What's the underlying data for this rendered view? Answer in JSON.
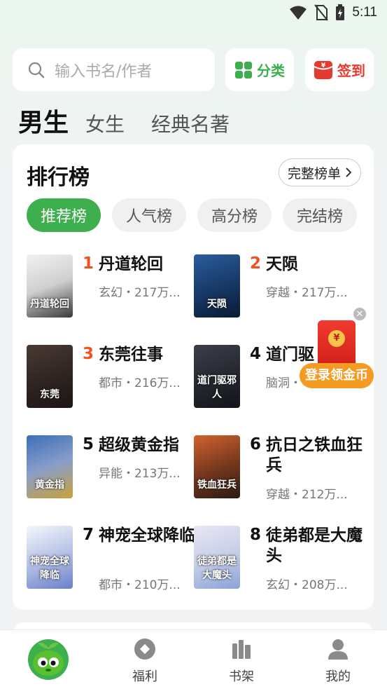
{
  "status_bar": {
    "time": "5:11"
  },
  "search": {
    "placeholder": "输入书名/作者"
  },
  "header_buttons": {
    "category": "分类",
    "checkin": "签到"
  },
  "gender_tabs": [
    {
      "label": "男生",
      "active": true
    },
    {
      "label": "女生",
      "active": false
    },
    {
      "label": "经典名著",
      "active": false
    }
  ],
  "ranking": {
    "title": "排行榜",
    "full_list": "完整榜单",
    "tabs": [
      {
        "label": "推荐榜",
        "active": true
      },
      {
        "label": "人气榜",
        "active": false
      },
      {
        "label": "高分榜",
        "active": false
      },
      {
        "label": "完结榜",
        "active": false
      }
    ],
    "books": [
      {
        "rank": "1",
        "title": "丹道轮回",
        "meta": "玄幻・217万...",
        "cover_text": "丹道轮回",
        "cover_colors": [
          "#f2f2f2",
          "#3a3a3a"
        ]
      },
      {
        "rank": "2",
        "title": "天陨",
        "meta": "穿越・217万...",
        "cover_text": "天陨",
        "cover_colors": [
          "#2a5d9e",
          "#0b1a33"
        ]
      },
      {
        "rank": "3",
        "title": "东莞往事",
        "meta": "都市・216万...",
        "cover_text": "东莞",
        "cover_colors": [
          "#4a3a34",
          "#1c1614"
        ]
      },
      {
        "rank": "4",
        "title": "道门驱",
        "meta": "脑洞・",
        "cover_text": "道门驱邪人",
        "cover_colors": [
          "#3b3f4a",
          "#111318"
        ]
      },
      {
        "rank": "5",
        "title": "超级黄金指",
        "meta": "异能・213万...",
        "cover_text": "黄金指",
        "cover_colors": [
          "#3a6fb8",
          "#f1d36a"
        ]
      },
      {
        "rank": "6",
        "title": "抗日之铁血狂兵",
        "meta": "穿越・212万...",
        "cover_text": "铁血狂兵",
        "cover_colors": [
          "#d2622e",
          "#2a1a12"
        ]
      },
      {
        "rank": "7",
        "title": "神宠全球降临",
        "meta": "都市・210万...",
        "cover_text": "神宠全球降临",
        "cover_colors": [
          "#f4f7fb",
          "#6a7fc9"
        ]
      },
      {
        "rank": "8",
        "title": "徒弟都是大魔头",
        "meta": "玄幻・208万...",
        "cover_text": "徒弟都是大魔头",
        "cover_colors": [
          "#eae6f4",
          "#8aa2d8"
        ]
      }
    ]
  },
  "red_packet": {
    "label": "登录领金币",
    "coin": "¥"
  },
  "bottom_nav": [
    {
      "label": "",
      "icon": "mascot-icon"
    },
    {
      "label": "福利",
      "icon": "gift-icon"
    },
    {
      "label": "书架",
      "icon": "bookshelf-icon"
    },
    {
      "label": "我的",
      "icon": "profile-icon"
    }
  ],
  "colors": {
    "accent": "#3daf4c",
    "rank_top": "#f4501e",
    "checkin": "#e53a2f"
  }
}
